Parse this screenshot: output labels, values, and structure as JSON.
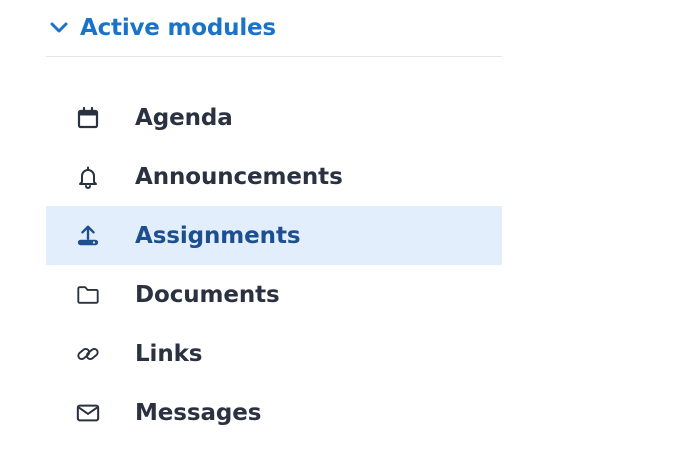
{
  "section": {
    "title": "Active modules",
    "expanded": true,
    "accent_color": "#1a73c8"
  },
  "menu": {
    "items": [
      {
        "label": "Agenda",
        "icon": "calendar-icon",
        "active": false
      },
      {
        "label": "Announcements",
        "icon": "bell-icon",
        "active": false
      },
      {
        "label": "Assignments",
        "icon": "upload-icon",
        "active": true
      },
      {
        "label": "Documents",
        "icon": "folder-icon",
        "active": false
      },
      {
        "label": "Links",
        "icon": "link-icon",
        "active": false
      },
      {
        "label": "Messages",
        "icon": "envelope-icon",
        "active": false
      }
    ],
    "active_background": "#e3eefc"
  }
}
